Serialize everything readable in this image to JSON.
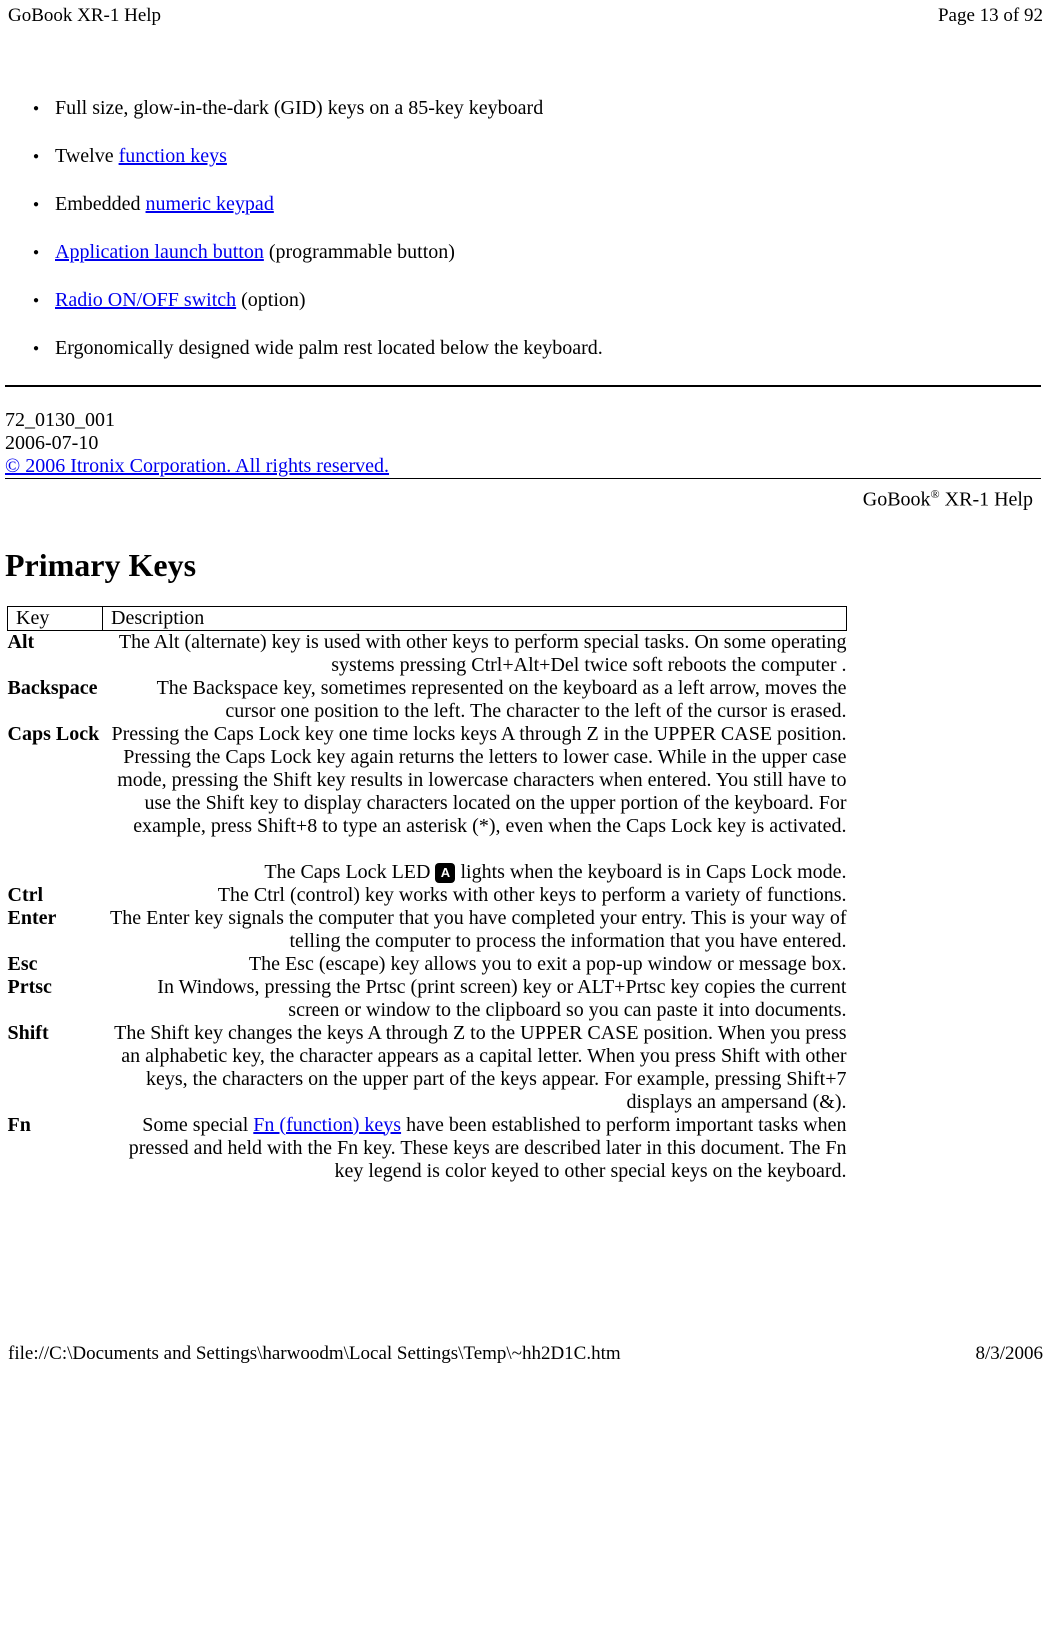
{
  "header": {
    "title": "GoBook XR-1 Help",
    "page_info": "Page 13 of 92"
  },
  "features": {
    "item0": "Full size, glow-in-the-dark (GID) keys on a 85-key keyboard",
    "item1_pre": "Twelve ",
    "item1_link": "function keys",
    "item2_pre": "Embedded ",
    "item2_link": "numeric keypad",
    "item3_link": "Application launch button",
    "item3_post": " (programmable button)",
    "item4_link": "Radio ON/OFF switch",
    "item4_post": " (option)",
    "item5": "Ergonomically designed wide palm rest located below the keyboard."
  },
  "doc_meta": {
    "doc_num": "72_0130_001",
    "date": "2006-07-10",
    "copyright": "© 2006 Itronix Corporation. All rights reserved."
  },
  "help_label": {
    "pre": "GoBook",
    "sup": "®",
    "post": " XR-1 Help"
  },
  "section_title": "Primary Keys",
  "table_headers": {
    "col1": "Key",
    "col2": "Description"
  },
  "keys": {
    "alt": {
      "name": "Alt",
      "desc": "The Alt (alternate) key is used with other keys to perform special tasks. On some operating systems pressing Ctrl+Alt+Del twice soft reboots the computer ."
    },
    "backspace": {
      "name": "Backspace",
      "desc": "The Backspace key, sometimes represented on the keyboard as a left arrow, moves the cursor one position to the left. The character to the left of the cursor is erased."
    },
    "capslock": {
      "name": "Caps Lock",
      "desc1": "Pressing the Caps Lock key one time locks keys A through Z in the UPPER CASE position. Pressing the Caps Lock key again returns the letters to lower case. While in the upper case mode, pressing the Shift key results in lowercase characters when entered. You still have to use the Shift key to display characters located on the upper portion of the keyboard. For example, press Shift+8 to type an asterisk (*), even when the Caps Lock key is activated.",
      "desc2_pre": "The Caps Lock LED ",
      "desc2_post": " lights when the keyboard is in Caps Lock mode.",
      "icon_label": "A"
    },
    "ctrl": {
      "name": "Ctrl",
      "desc": "The Ctrl (control) key works with other keys to perform a variety of functions."
    },
    "enter": {
      "name": "Enter",
      "desc": "The Enter key signals the computer that you have completed your entry. This is your way of telling the computer to process the information that you have entered."
    },
    "esc": {
      "name": "Esc",
      "desc": "The Esc (escape) key allows you to exit a pop-up window or message box."
    },
    "prtsc": {
      "name": "Prtsc",
      "desc": "In Windows, pressing the Prtsc (print screen) key or ALT+Prtsc key copies the current screen or window to the clipboard so you can paste it into documents."
    },
    "shift": {
      "name": "Shift",
      "desc": "The Shift key changes the keys A through Z to the UPPER CASE position. When you press an alphabetic key, the character appears as a capital letter. When you press Shift with other keys, the characters on the upper part of the keys appear. For example, pressing Shift+7 displays an ampersand (&)."
    },
    "fn": {
      "name": "Fn",
      "desc_pre": "Some special ",
      "desc_link": "Fn (function) keys",
      "desc_post": " have been established to perform important tasks when pressed and held with the Fn key. These keys are described later in this document.  The Fn key legend is color keyed to other special keys on the keyboard."
    }
  },
  "footer": {
    "path": "file://C:\\Documents and Settings\\harwoodm\\Local Settings\\Temp\\~hh2D1C.htm",
    "date": "8/3/2006"
  }
}
